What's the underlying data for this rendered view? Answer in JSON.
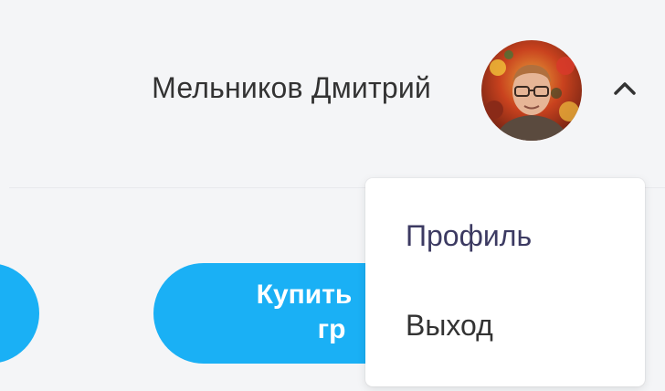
{
  "header": {
    "user_name": "Мельников Дмитрий",
    "avatar_icon": "user-avatar-photo",
    "toggle_icon": "chevron-up-icon"
  },
  "actions": {
    "buy_label_line1": "Купить",
    "buy_label_line2": "гр"
  },
  "dropdown": {
    "items": [
      {
        "label": "Профиль"
      },
      {
        "label": "Выход"
      }
    ]
  },
  "colors": {
    "accent": "#1ab0f5",
    "background": "#f4f5f7",
    "menu_profile_text": "#3c3a62",
    "text": "#333333"
  }
}
